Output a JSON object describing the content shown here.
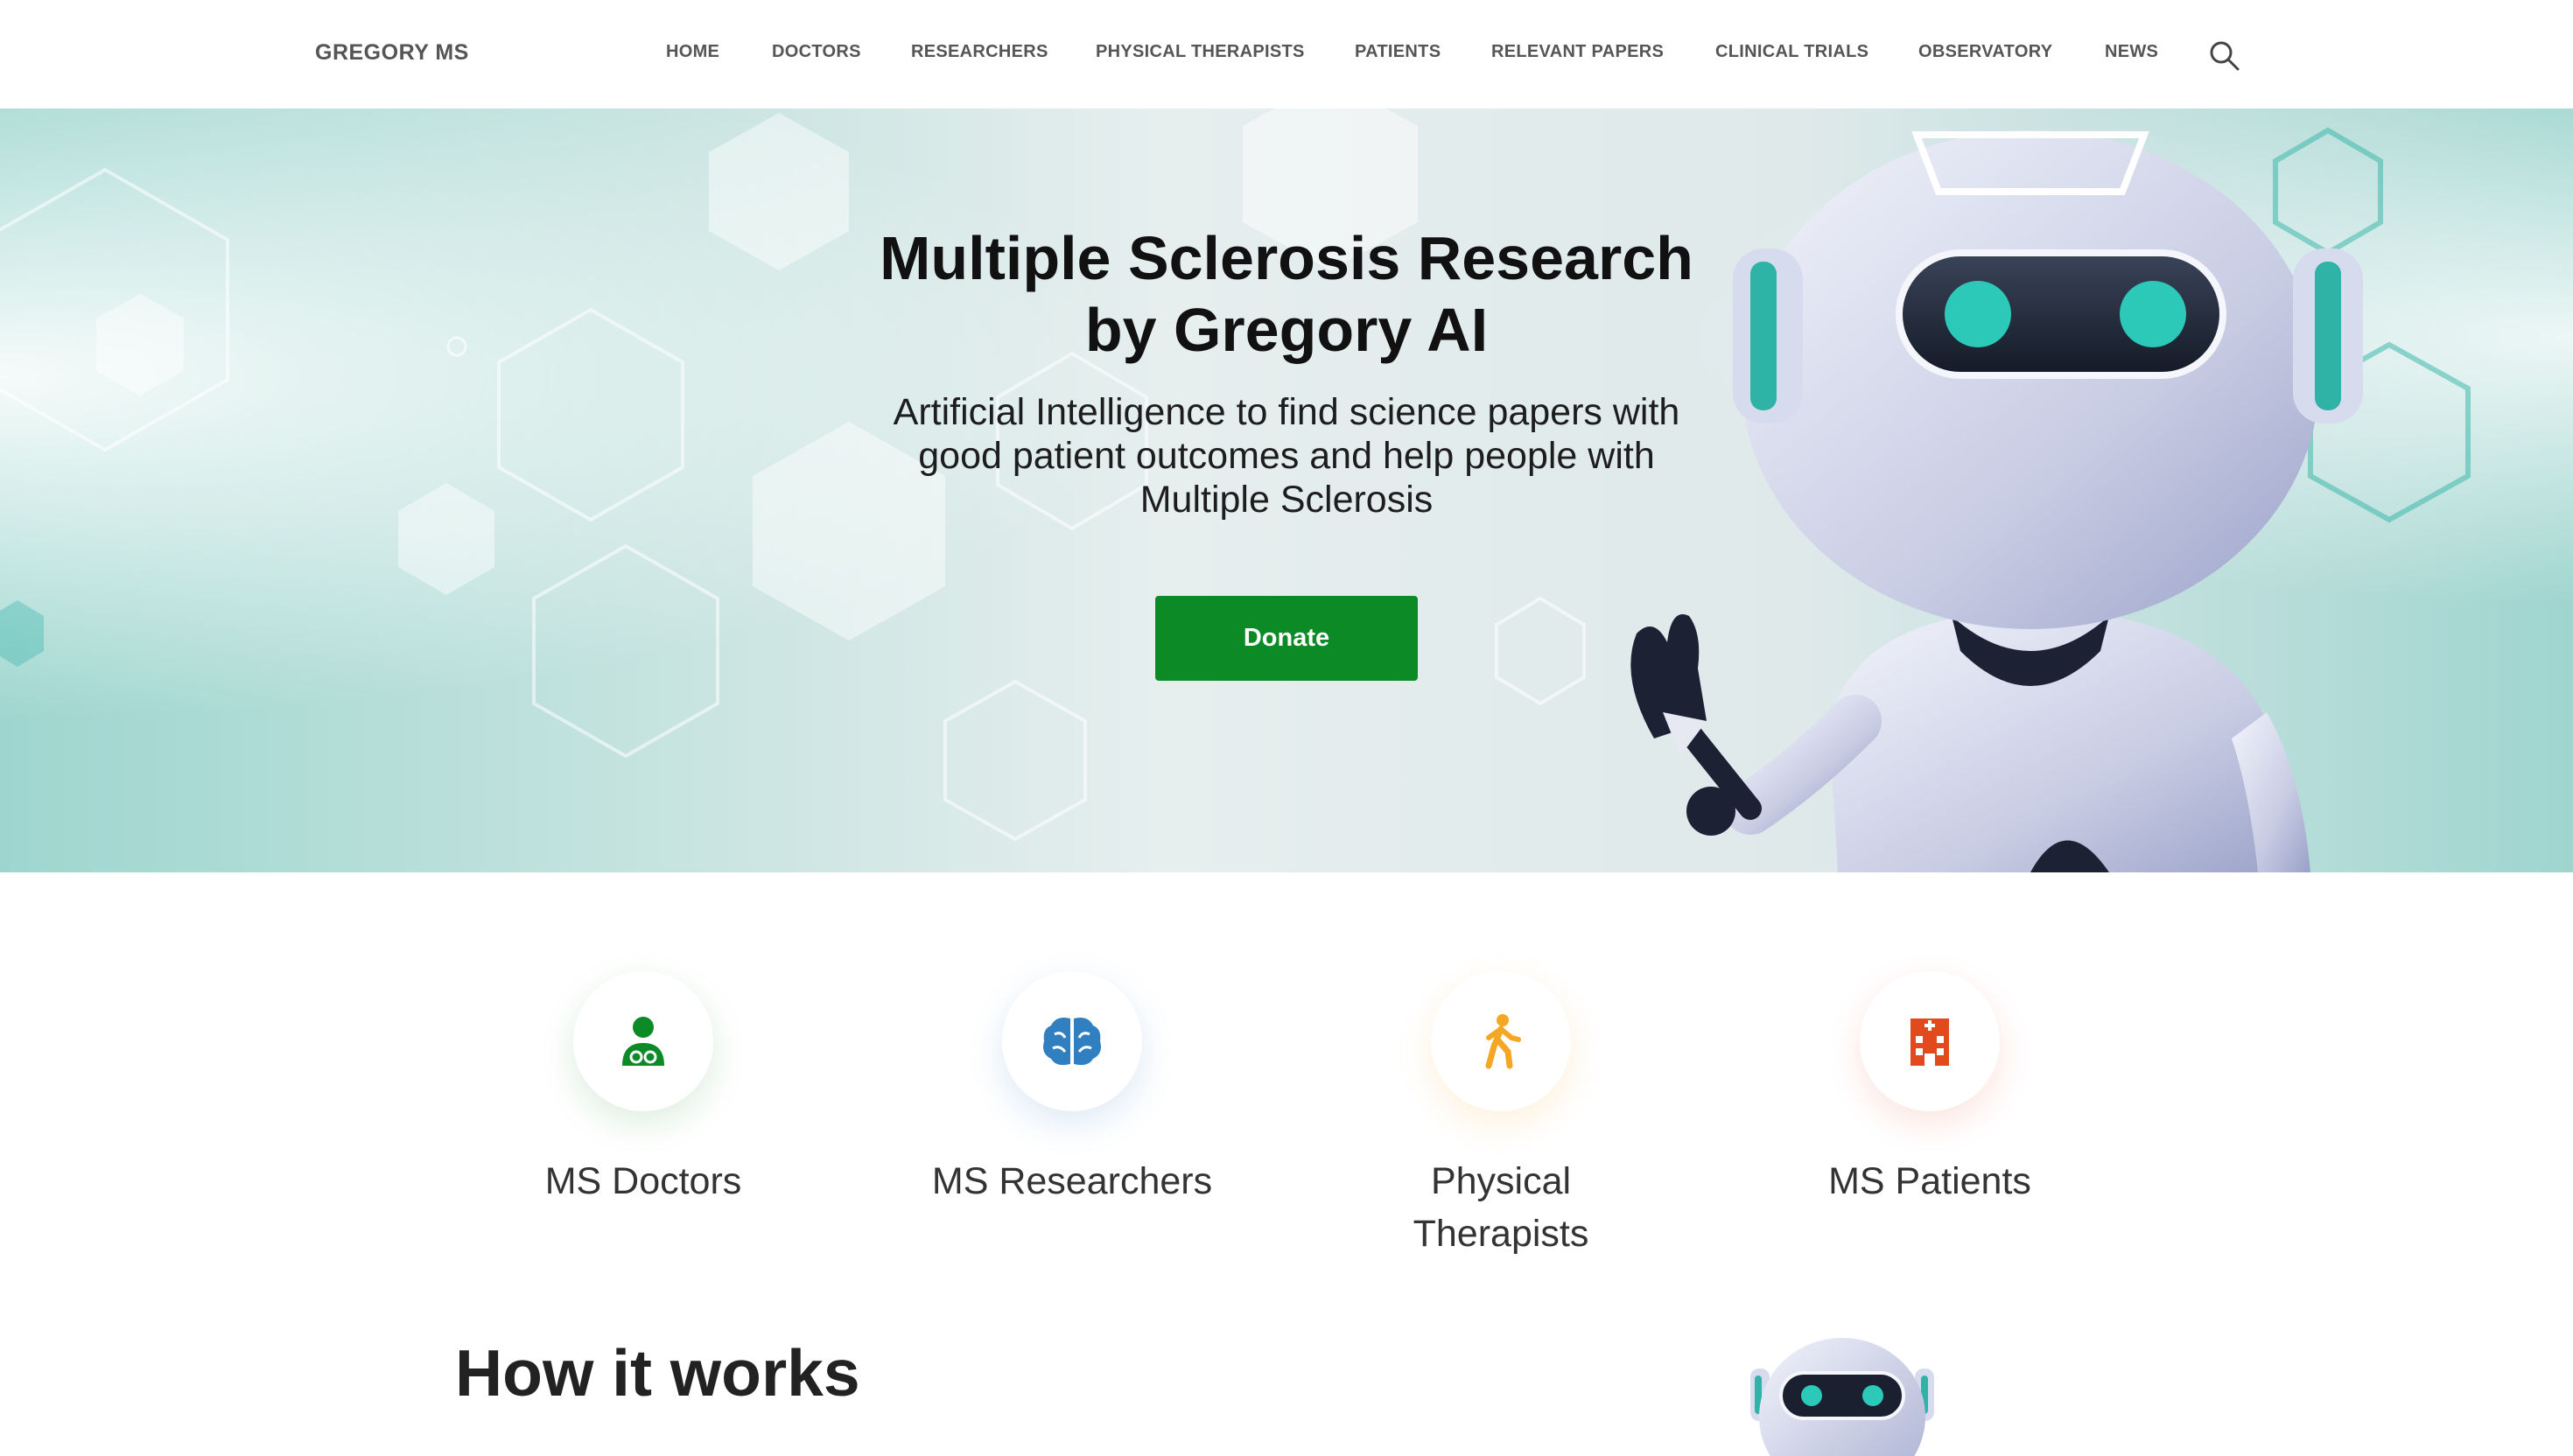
{
  "header": {
    "brand": "GREGORY MS",
    "nav": [
      "HOME",
      "DOCTORS",
      "RESEARCHERS",
      "PHYSICAL THERAPISTS",
      "PATIENTS",
      "RELEVANT PAPERS",
      "CLINICAL TRIALS",
      "OBSERVATORY",
      "NEWS"
    ],
    "search_icon": "search-icon"
  },
  "hero": {
    "title_line1": "Multiple Sclerosis Research",
    "title_line2": "by Gregory AI",
    "subtitle_line1": "Artificial Intelligence to find science papers with",
    "subtitle_line2": "good patient outcomes and help people with",
    "subtitle_line3": "Multiple Sclerosis",
    "donate_label": "Donate",
    "accent_green": "#0b8a25",
    "teal": "#2fb3a6"
  },
  "audiences": [
    {
      "label": "MS Doctors",
      "icon": "doctor-icon",
      "color": "#0b8a25"
    },
    {
      "label": "MS Researchers",
      "icon": "brain-icon",
      "color": "#2f7fc1"
    },
    {
      "label_line1": "Physical",
      "label_line2": "Therapists",
      "icon": "walking-person-icon",
      "color": "#f5a623"
    },
    {
      "label": "MS Patients",
      "icon": "hospital-icon",
      "color": "#e24a1d"
    }
  ],
  "section": {
    "how_title": "How it works"
  }
}
